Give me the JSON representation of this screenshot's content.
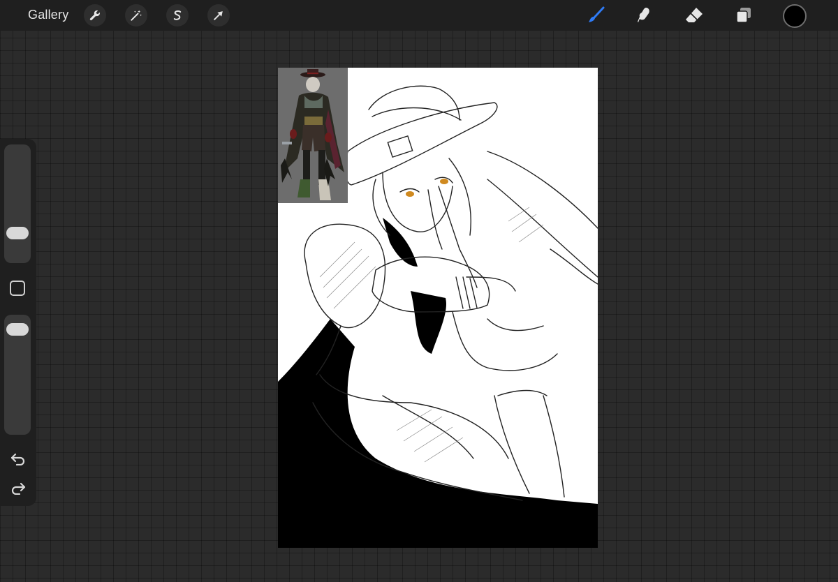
{
  "toolbar": {
    "gallery_label": "Gallery",
    "left_actions": [
      {
        "icon": "wrench-icon"
      },
      {
        "icon": "magic-wand-icon"
      },
      {
        "icon": "selection-s-icon"
      },
      {
        "icon": "arrow-transform-icon"
      }
    ],
    "right_tools": [
      {
        "icon": "brush-icon",
        "active": true
      },
      {
        "icon": "smudge-icon",
        "active": false
      },
      {
        "icon": "eraser-icon",
        "active": false
      },
      {
        "icon": "layers-icon",
        "active": false
      }
    ],
    "current_color": "#000000"
  },
  "sidebar": {
    "brush_size_level": 0.21,
    "opacity_level": 0.94,
    "modify_icon": "square-icon",
    "undo_icon": "undo-arrow-icon",
    "redo_icon": "redo-arrow-icon"
  },
  "theme": {
    "accent": "#2f7bf5",
    "toolbar_bg": "#1f1f1f",
    "canvas_bg": "#ffffff",
    "workspace_bg": "#2b2b2b"
  }
}
